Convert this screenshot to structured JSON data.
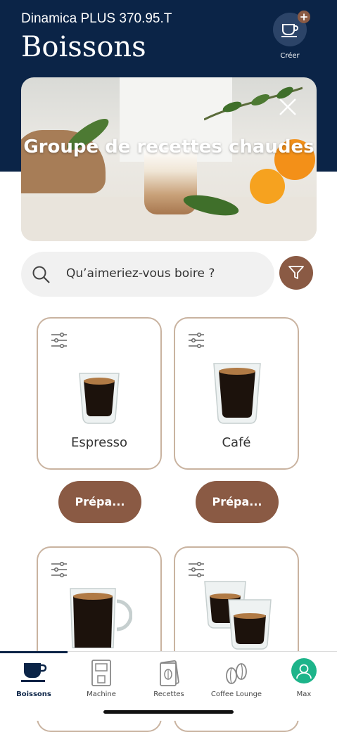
{
  "header": {
    "device_name": "Dinamica PLUS 370.95.T",
    "title": "Boissons",
    "create_label": "Créer"
  },
  "banner": {
    "title": "Groupe de recettes chaudes"
  },
  "search": {
    "placeholder": "Qu’aimeriez-vous boire ?"
  },
  "drinks": [
    {
      "name": "Espresso",
      "button": "Prépa..."
    },
    {
      "name": "Café",
      "button": "Prépa..."
    },
    {
      "name": ""
    },
    {
      "name": ""
    }
  ],
  "tabs": [
    {
      "label": "Boissons",
      "icon": "cup-icon",
      "active": true
    },
    {
      "label": "Machine",
      "icon": "machine-icon"
    },
    {
      "label": "Recettes",
      "icon": "recipes-icon"
    },
    {
      "label": "Coffee Lounge",
      "icon": "coffee-beans-icon"
    },
    {
      "label": "Max",
      "icon": "avatar-icon"
    }
  ],
  "colors": {
    "header_bg": "#0b2447",
    "accent_brown": "#8a5a44",
    "card_border": "#c9b3a0"
  }
}
